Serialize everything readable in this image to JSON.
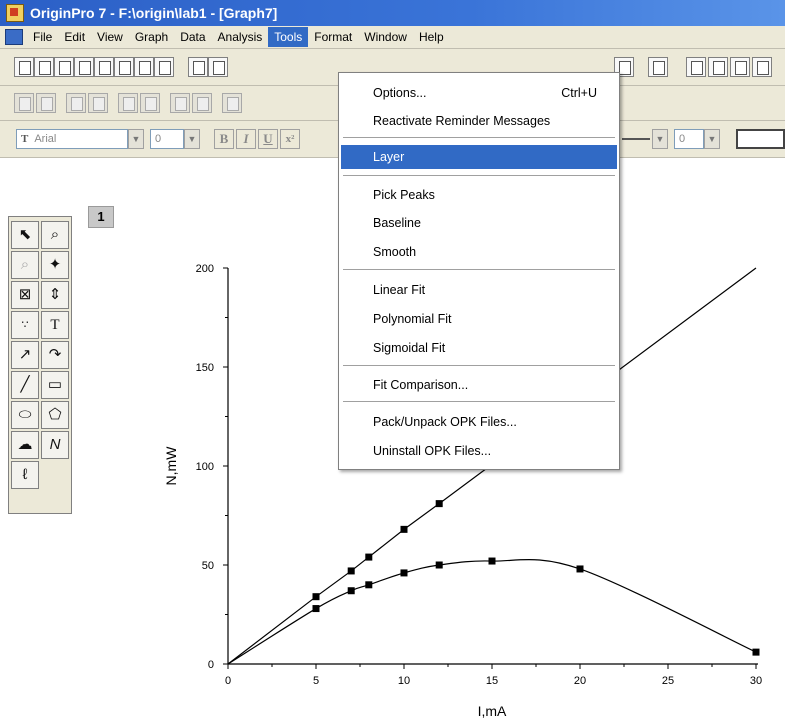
{
  "window": {
    "title": "OriginPro 7 - F:\\origin\\lab1 - [Graph7]"
  },
  "menubar": {
    "items": [
      "File",
      "Edit",
      "View",
      "Graph",
      "Data",
      "Analysis",
      "Tools",
      "Format",
      "Window",
      "Help"
    ],
    "active": "Tools"
  },
  "format_bar": {
    "font": "Arial",
    "size": "0",
    "line_width": "0",
    "buttons": [
      "B",
      "I",
      "U",
      "x²"
    ]
  },
  "graph": {
    "layer_number": "1"
  },
  "tools_menu": {
    "items": [
      {
        "label": "Options...",
        "shortcut": "Ctrl+U"
      },
      {
        "label": "Reactivate Reminder Messages"
      },
      {
        "label": "Layer",
        "highlighted": true
      },
      {
        "label": "Pick Peaks"
      },
      {
        "label": "Baseline"
      },
      {
        "label": "Smooth"
      },
      {
        "label": "Linear Fit"
      },
      {
        "label": "Polynomial Fit"
      },
      {
        "label": "Sigmoidal Fit"
      },
      {
        "label": "Fit Comparison..."
      },
      {
        "label": "Pack/Unpack OPK Files..."
      },
      {
        "label": "Uninstall OPK Files..."
      }
    ]
  },
  "toolbox": {
    "tools": [
      "pointer-icon",
      "zoom-icon",
      "zoom-out-icon",
      "data-reader-icon",
      "screen-reader-icon",
      "data-selector-icon",
      "mask-icon",
      "text-icon",
      "arrow-icon",
      "curved-arrow-icon",
      "line-icon",
      "rectangle-icon",
      "ellipse-icon",
      "polygon-icon",
      "region-icon",
      "polyline-icon",
      "freehand-icon"
    ]
  },
  "chart_data": {
    "type": "scatter",
    "xlabel": "I,mA",
    "ylabel": "N,mW",
    "xlim": [
      0,
      30
    ],
    "ylim": [
      0,
      200
    ],
    "x_ticks": [
      0,
      5,
      10,
      15,
      20,
      25,
      30
    ],
    "y_ticks": [
      0,
      50,
      100,
      150,
      200
    ],
    "series": [
      {
        "x": [
          0,
          5,
          7,
          8,
          10,
          12,
          30
        ],
        "y": [
          0,
          34,
          47,
          54,
          68,
          81,
          200
        ],
        "style": "line-with-points"
      },
      {
        "x": [
          0,
          5,
          7,
          8,
          10,
          12,
          15,
          20,
          30
        ],
        "y": [
          0,
          28,
          37,
          40,
          46,
          50,
          52,
          48,
          6
        ],
        "style": "smooth-curve-with-points"
      }
    ],
    "grid": false
  },
  "colors": {
    "titlebar": "#2b5fc6",
    "menu_highlight": "#316ac5",
    "chrome": "#ece9d8"
  }
}
